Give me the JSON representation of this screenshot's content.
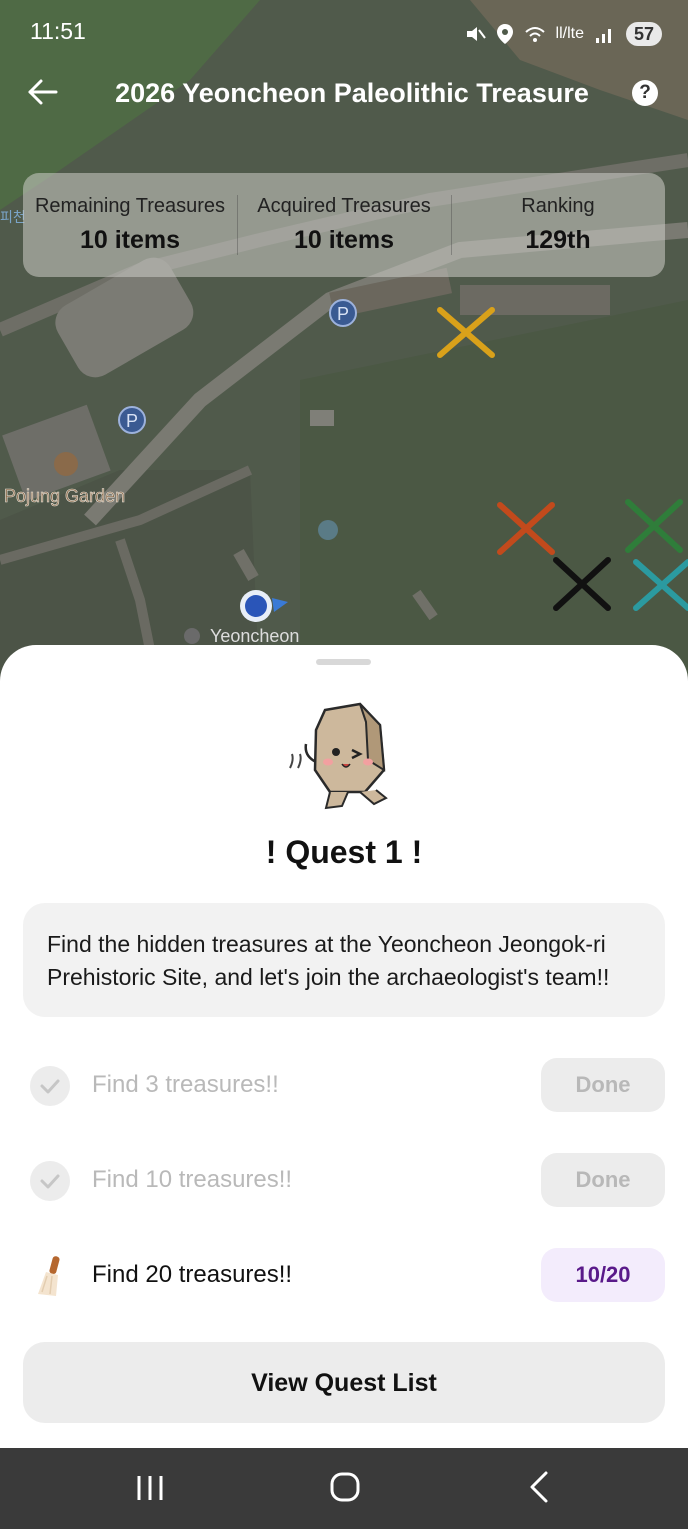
{
  "status_bar": {
    "time": "11:51",
    "network_text": "ll/lte",
    "battery": "57",
    "icons": [
      "mute-icon",
      "location-icon",
      "wifi-icon",
      "signal-icon",
      "battery-icon"
    ]
  },
  "header": {
    "title": "2026 Yeoncheon Paleolithic Treasure",
    "back_icon": "arrow-left-icon",
    "help_label": "?"
  },
  "stats": [
    {
      "label": "Remaining Treasures",
      "value": "10 items"
    },
    {
      "label": "Acquired Treasures",
      "value": "10 items"
    },
    {
      "label": "Ranking",
      "value": "129th"
    }
  ],
  "map": {
    "labels": {
      "garden": "Pojung Garden",
      "place": "Yeoncheon",
      "edge": "피천"
    },
    "parking_label": "P",
    "marker_colors": [
      "#d9a11a",
      "#c24a1c",
      "#2f7d3a",
      "#111111",
      "#2b9aa0"
    ]
  },
  "quest": {
    "title": "! Quest 1 !",
    "description": "Find the hidden treasures at the Yeoncheon Jeongok-ri Prehistoric Site, and let's join the archaeologist's team!!",
    "tasks": [
      {
        "text": "Find 3 treasures!!",
        "status": "Done",
        "icon": "check-icon"
      },
      {
        "text": "Find 10 treasures!!",
        "status": "Done",
        "icon": "check-icon"
      },
      {
        "text": "Find 20 treasures!!",
        "status": "10/20",
        "icon": "brush-icon"
      }
    ],
    "view_button": "View Quest List"
  },
  "colors": {
    "progress_text": "#5a1a8a",
    "progress_bg": "#f3ecfc",
    "nav_bar": "#3a3a3a"
  }
}
